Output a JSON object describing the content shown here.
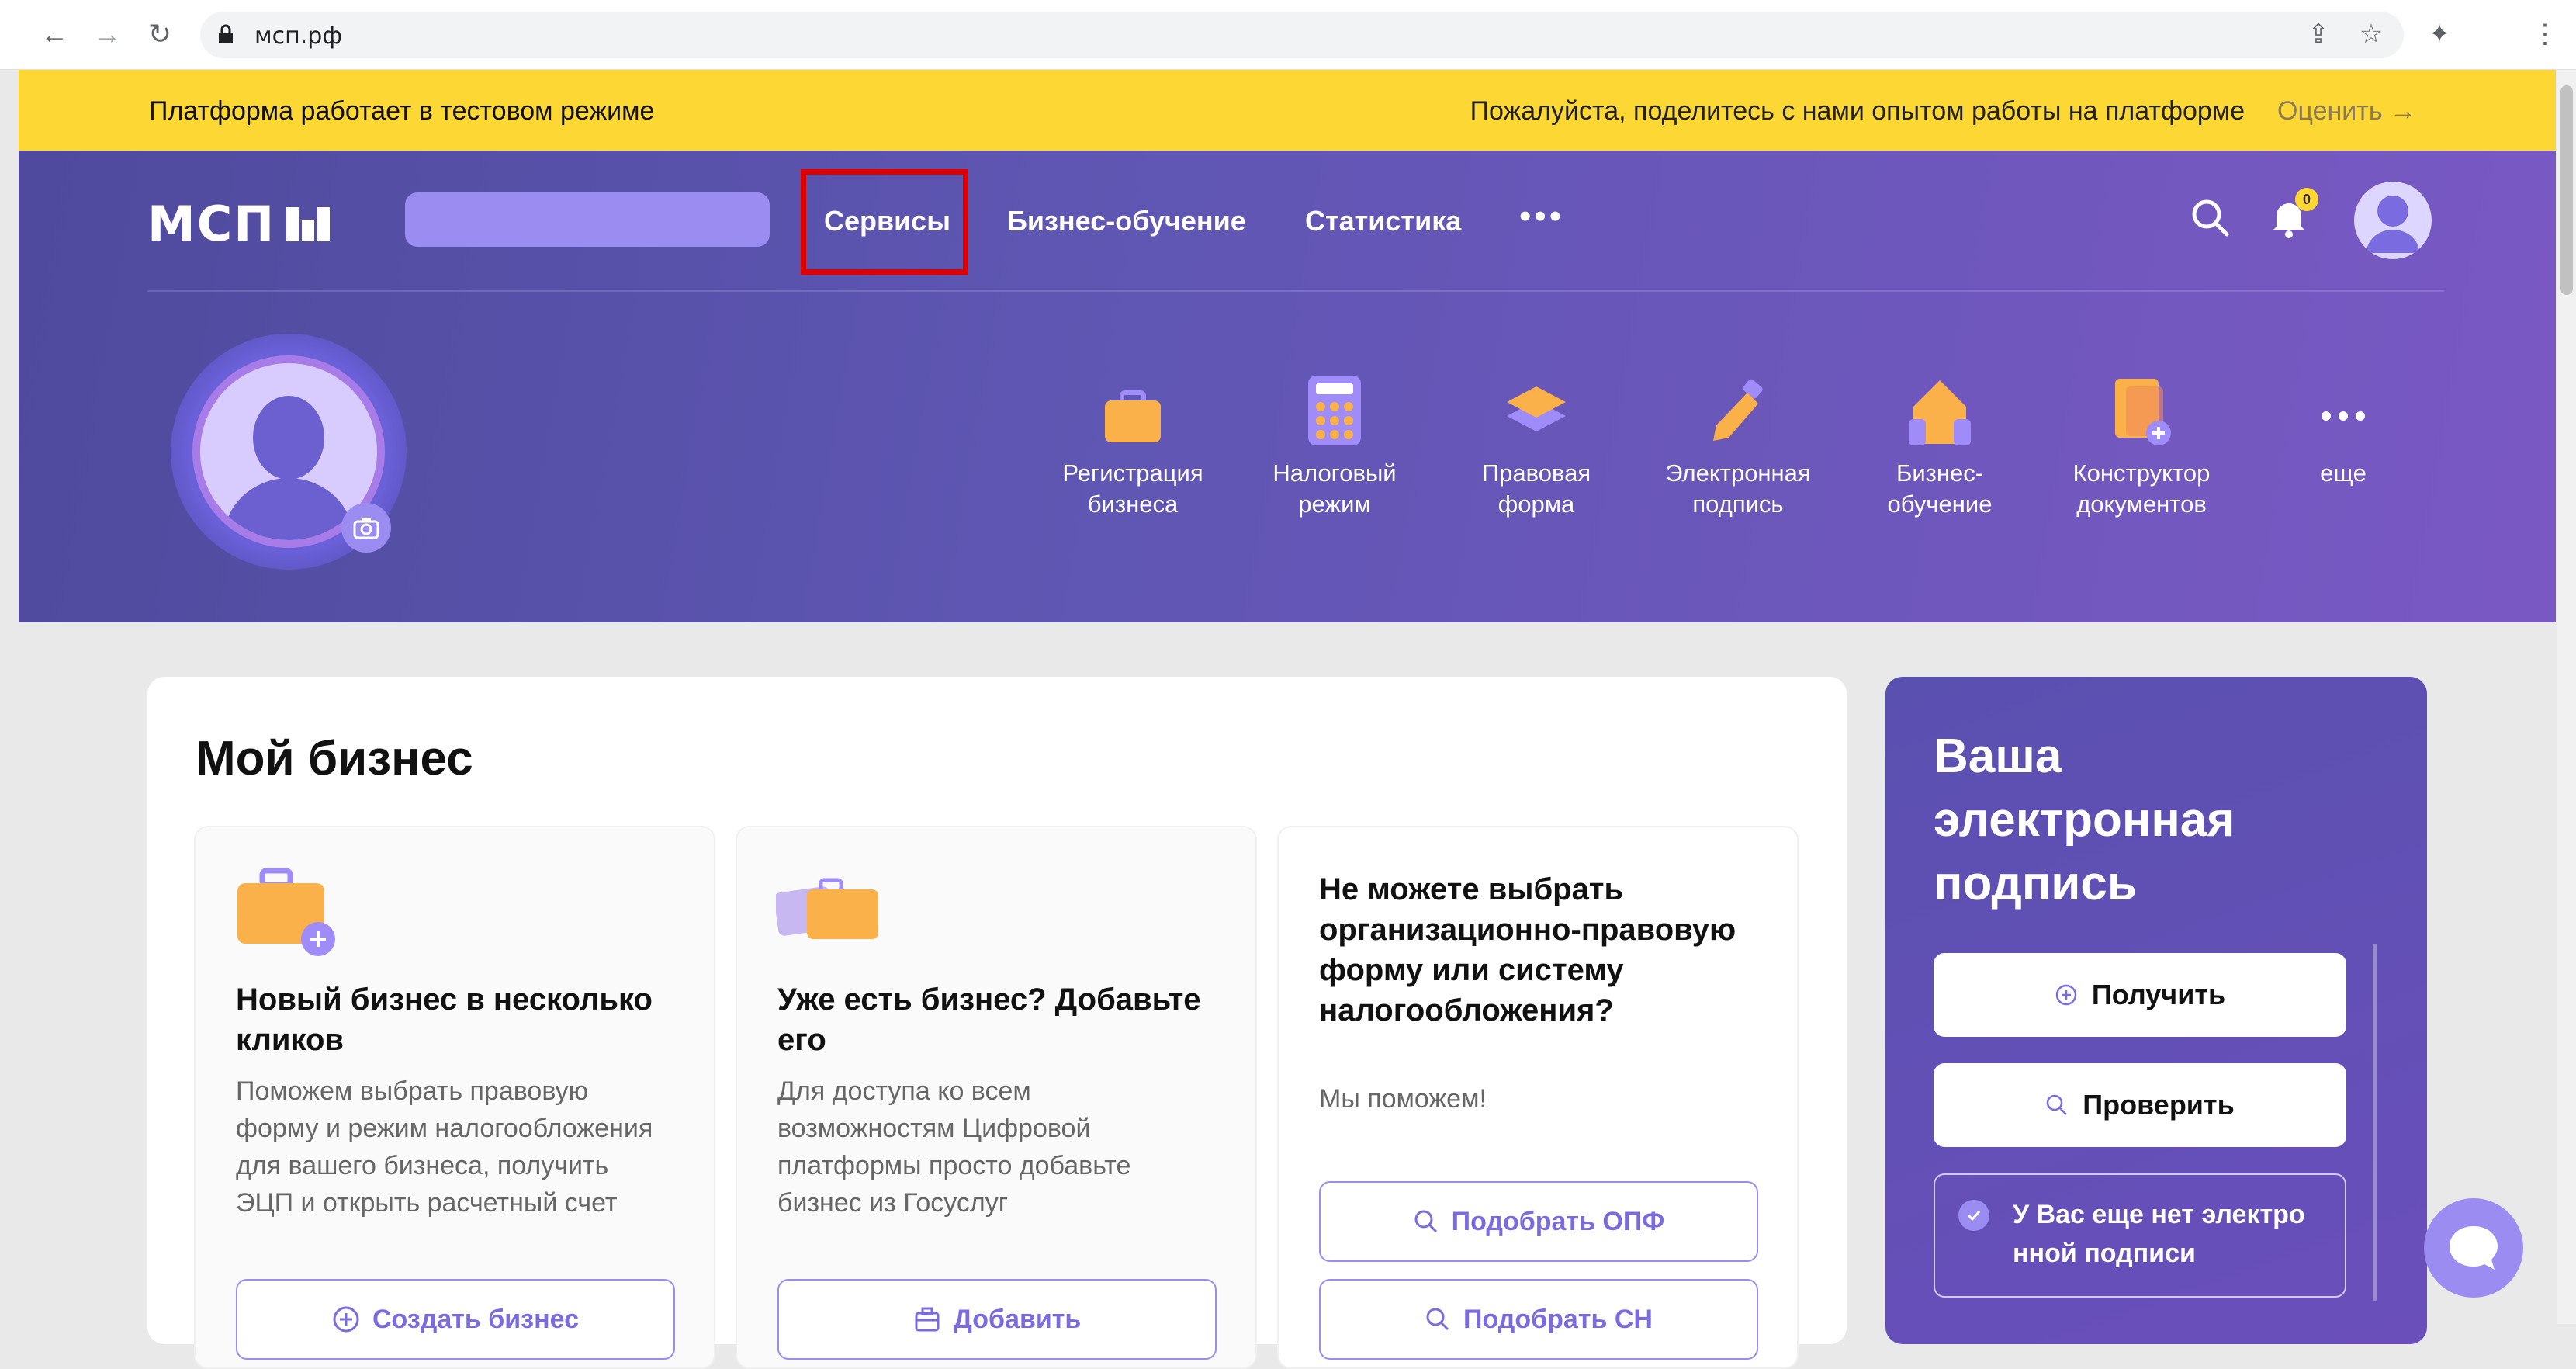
{
  "browser": {
    "url": "мсп.рф",
    "back_icon": "arrow-left-icon",
    "forward_icon": "arrow-right-icon",
    "reload_icon": "reload-icon"
  },
  "banner": {
    "left_text": "Платформа работает в тестовом режиме",
    "right_text": "Пожалуйста, поделитесь с нами опытом работы на платформе",
    "rate_link": "Оценить →"
  },
  "header": {
    "logo_text": "МСП",
    "nav": [
      "Сервисы",
      "Бизнес-обучение",
      "Статистика"
    ],
    "more": "•••",
    "notification_count": "0"
  },
  "services": [
    {
      "label_1": "Регистрация",
      "label_2": "бизнеса",
      "icon": "briefcase-icon"
    },
    {
      "label_1": "Налоговый",
      "label_2": "режим",
      "icon": "calculator-icon"
    },
    {
      "label_1": "Правовая",
      "label_2": "форма",
      "icon": "layers-icon"
    },
    {
      "label_1": "Электронная",
      "label_2": "подпись",
      "icon": "pen-icon"
    },
    {
      "label_1": "Бизнес-",
      "label_2": "обучение",
      "icon": "house-icon"
    },
    {
      "label_1": "Конструктор",
      "label_2": "документов",
      "icon": "document-plus-icon"
    },
    {
      "label_1": "еще",
      "label_2": "",
      "icon": "more-dots-icon"
    }
  ],
  "main": {
    "title": "Мой бизнес",
    "cards": [
      {
        "title": "Новый бизнес в несколько кликов",
        "text": "Поможем выбрать правовую форму и режим налогообложения для вашего бизнеса, получить ЭЦП и открыть расчетный счет",
        "button": "Создать бизнес"
      },
      {
        "title": "Уже есть бизнес? Добавьте его",
        "text": "Для доступа ко всем возможностям Цифровой платформы просто добавьте бизнес из Госуслуг",
        "button": "Добавить"
      },
      {
        "title": "Не можете выбрать организационно-правовую форму или систему налогообложения?",
        "text": "Мы поможем!",
        "button_1": "Подобрать ОПФ",
        "button_2": "Подобрать СН"
      }
    ]
  },
  "signature": {
    "title": "Ваша электронная подпись",
    "get": "Получить",
    "check": "Проверить",
    "note": "У Вас еще нет электро нной подписи"
  },
  "colors": {
    "banner": "#fdd835",
    "hero": "#5e56b2",
    "accent": "#9b8cf2",
    "highlight_box": "#e00000"
  }
}
